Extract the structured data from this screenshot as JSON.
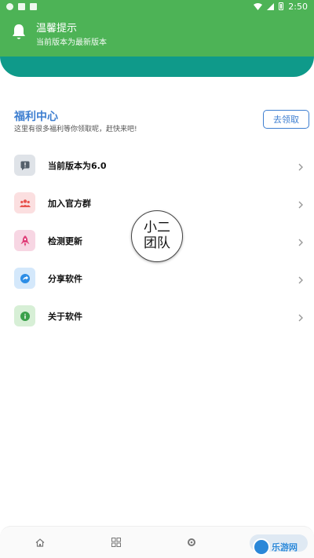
{
  "status_bar": {
    "time": "2:50"
  },
  "notification": {
    "title": "温馨提示",
    "subtitle": "当前版本为最新版本",
    "icon": "bell-icon"
  },
  "benefit": {
    "title": "福利中心",
    "description": "这里有很多福利等你领取呢，赶快来吧!",
    "button_label": "去领取"
  },
  "menu": {
    "items": [
      {
        "label": "当前版本为6.0",
        "icon": "message-alert-icon",
        "icon_bg": "#dfe3e8",
        "icon_color": "#55606b"
      },
      {
        "label": "加入官方群",
        "icon": "group-icon",
        "icon_bg": "#fbdfe0",
        "icon_color": "#e8534e"
      },
      {
        "label": "检测更新",
        "icon": "rocket-icon",
        "icon_bg": "#f7d6e3",
        "icon_color": "#e0407a"
      },
      {
        "label": "分享软件",
        "icon": "share-icon",
        "icon_bg": "#d4e8fb",
        "icon_color": "#2c8de6"
      },
      {
        "label": "关于软件",
        "icon": "info-icon",
        "icon_bg": "#d7efd6",
        "icon_color": "#3aa04a"
      }
    ]
  },
  "floating_badge": {
    "line1": "小二",
    "line2": "团队"
  },
  "bottom_nav": {
    "items": [
      "home-icon",
      "grid-icon",
      "settings-icon",
      "profile-icon"
    ]
  },
  "watermark": {
    "text": "乐游网"
  },
  "colors": {
    "primary_green": "#4db356",
    "teal": "#0f9a8a",
    "accent_blue": "#3d7ed0"
  }
}
